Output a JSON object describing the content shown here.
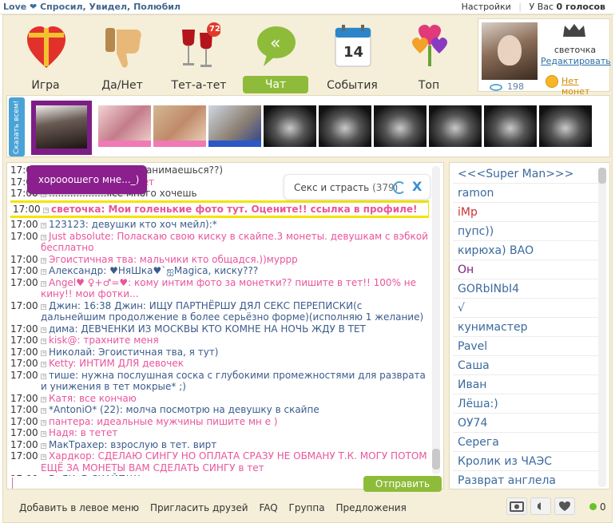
{
  "topbar": {
    "brand_prefix": "Love",
    "brand_suffix": "Спросил, Увидел, Полюбил",
    "settings": "Настройки",
    "votes_label": "У Вас",
    "votes_value": "0 голосов"
  },
  "nav": {
    "items": [
      {
        "label": "Игра",
        "icon": "heart-gift-icon"
      },
      {
        "label": "Да/Нет",
        "icon": "thumbs-down-icon"
      },
      {
        "label": "Тет-а-тет",
        "icon": "wine-glasses-icon",
        "badge": "72"
      },
      {
        "label": "Чат",
        "icon": "chat-bubble-icon"
      },
      {
        "label": "События",
        "icon": "calendar-icon",
        "day": "14"
      },
      {
        "label": "Топ",
        "icon": "hearts-bouquet-icon"
      }
    ]
  },
  "profile": {
    "username": "светочка",
    "edit": "Редактировать",
    "views": "198",
    "no_coins": "Нет монет"
  },
  "strip": {
    "say_all": "Сказать всем!"
  },
  "room": {
    "name": "Секс и страсть",
    "count": "(379)",
    "close": "X"
  },
  "tooltip": "хорооошего мне..._)",
  "messages": [
    {
      "time": "17:00",
      "text": "...... ........ мяу  чем занимаешься??)",
      "color": "#444444"
    },
    {
      "time": "17:00",
      "text": "Д........ просики в тет",
      "color": "#e9559c"
    },
    {
      "time": "17:00",
      "text": "...................lice  много хочешь",
      "color": "#444444"
    },
    {
      "time": "17:00",
      "text": "светочка: Мои голенькие фото тут. Оцените!! ссылка в профиле!",
      "color": "#e9559c",
      "highlight": true
    },
    {
      "time": "17:00",
      "text": "123123: девушки кто хоч мейл):*",
      "color": "#3c5c8c"
    },
    {
      "time": "17:00",
      "text": "Just absolute: Поласкаю свою киску в скайпе.3 монеты. девушкам с вэбкой бесплатно",
      "color": "#e9559c"
    },
    {
      "time": "17:00",
      "text": "Эгоистичная тва: мальчики кто общадся.))мурpp",
      "color": "#e9559c"
    },
    {
      "time": "17:00",
      "text": "Александр: ♥НяШка♥`ஐMagica,  киску???",
      "color": "#3c5c8c"
    },
    {
      "time": "17:00",
      "text": "Angel♥ ♀+♂=♥: кому интим фото за монетки?? пишите в тет!! 100% не кину!! мои фотки...",
      "color": "#e9559c"
    },
    {
      "time": "17:00",
      "text": "Джин: 16:38 Джин: ИЩУ  ПАРТНЁРШУ  ДЯЛ СЕКС ПЕРЕПИСКИ(с дальнейшим продолжение в более серьёзно форме)(исполняю 1 желание)",
      "color": "#3c5c8c"
    },
    {
      "time": "17:00",
      "text": "дима: ДЕВЧЕНКИ ИЗ МОСКВЫ КТО КОМНЕ НА НОЧЬ ЖДУ В ТЕТ",
      "color": "#3c5c8c"
    },
    {
      "time": "17:00",
      "text": "kisk@: трахните меня",
      "color": "#e9559c"
    },
    {
      "time": "17:00",
      "text": "Николай: Эгоистичная тва, я тут)",
      "color": "#3c5c8c"
    },
    {
      "time": "17:00",
      "text": "Ketty: ИНТИМ ДЛЯ девочек",
      "color": "#e9559c"
    },
    {
      "time": "17:00",
      "text": "тише: нужна послушная соска с глубокими промежностями для разврата и унижения в тет мокрые* ;)",
      "color": "#3c5c8c"
    },
    {
      "time": "17:00",
      "text": "Катя: все кончаю",
      "color": "#e9559c"
    },
    {
      "time": "17:00",
      "text": "*AntoniO* (22): молча посмотрю на девушку в скайпе",
      "color": "#3c5c8c"
    },
    {
      "time": "17:00",
      "text": "пантера: идеальные мужчины пишите мн е )",
      "color": "#e9559c"
    },
    {
      "time": "17:00",
      "text": "Надя: в тетет",
      "color": "#e9559c"
    },
    {
      "time": "17:00",
      "text": "МакТрахер: взрослую в тет. вирт",
      "color": "#3c5c8c"
    },
    {
      "time": "17:00",
      "text": "Хардкор: СДЕЛАЮ СИНГУ  НО ОПЛАТА СРАЗУ НЕ ОБМАНУ Т.К. МОГУ ПОТОМ ЕЩЁ ЗА МОНЕТЫ ВАМ СДЕЛАТЬ СИНГУ в тет",
      "color": "#e9559c"
    },
    {
      "time": "17:00",
      "text": "ВоЛК: В СКАЙП!!!!",
      "color": "#3c5c8c"
    }
  ],
  "send": "Отправить",
  "users": [
    {
      "name": "<<<Super Man>>>",
      "color": "#3d6a9d"
    },
    {
      "name": "ramon",
      "color": "#3d6a9d"
    },
    {
      "name": "iMp",
      "color": "#cc3333"
    },
    {
      "name": "пупс))",
      "color": "#3d6a9d"
    },
    {
      "name": "кирюха) ВАО",
      "color": "#3d6a9d"
    },
    {
      "name": "Он",
      "color": "#7a1f80"
    },
    {
      "name": "GORbINbI4",
      "color": "#3d6a9d"
    },
    {
      "name": "√",
      "color": "#3d6a9d"
    },
    {
      "name": "кунимастер",
      "color": "#3d6a9d"
    },
    {
      "name": "Pavel",
      "color": "#3d6a9d"
    },
    {
      "name": "Саша",
      "color": "#3d6a9d"
    },
    {
      "name": "Иван",
      "color": "#3d6a9d"
    },
    {
      "name": "Лёша:)",
      "color": "#3d6a9d"
    },
    {
      "name": "ОУ74",
      "color": "#3d6a9d"
    },
    {
      "name": "Серега",
      "color": "#3d6a9d"
    },
    {
      "name": "Кролик из ЧАЭС",
      "color": "#3d6a9d"
    },
    {
      "name": "Разврат англела",
      "color": "#3d6a9d"
    }
  ],
  "footer": {
    "links": [
      "Добавить в левое меню",
      "Пригласить друзей",
      "FAQ",
      "Группа",
      "Предложения"
    ],
    "online": "0"
  },
  "colors": {
    "accent_green": "#8ebc3a",
    "highlight_yellow": "#f4e400",
    "tooltip_purple": "#8a1f8d",
    "frame_bg": "#f5efd9"
  }
}
